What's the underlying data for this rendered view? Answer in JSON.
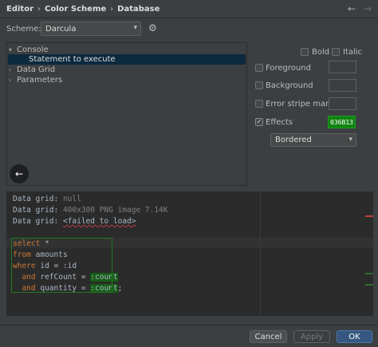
{
  "breadcrumb": {
    "items": [
      "Editor",
      "Color Scheme",
      "Database"
    ],
    "separator": "›"
  },
  "nav": {
    "back": "←",
    "forward": "→"
  },
  "scheme": {
    "label": "Scheme:",
    "value": "Darcula",
    "arrow": "▾",
    "gear": "⚙"
  },
  "tree": {
    "items": [
      {
        "label": "Console",
        "toggle": "▾"
      },
      {
        "label": "Statement to execute",
        "toggle": ""
      },
      {
        "label": "Data Grid",
        "toggle": "›"
      },
      {
        "label": "Parameters",
        "toggle": "›"
      }
    ],
    "back_button": "←"
  },
  "attributes": {
    "bold": "Bold",
    "italic": "Italic",
    "foreground": "Foreground",
    "background": "Background",
    "error_stripe": "Error stripe mark",
    "effects": "Effects",
    "effects_color": "036B13",
    "effects_color_hex": "#118411",
    "effects_type": "Bordered",
    "check": "✓",
    "arrow": "▾"
  },
  "preview": {
    "line1": {
      "label": "Data grid:",
      "value": "null"
    },
    "line2": {
      "label": "Data grid:",
      "value": "400x300 PNG image 7.14K"
    },
    "line3": {
      "label": "Data grid:",
      "value": "<failed to load>"
    },
    "sql": {
      "select": "select",
      "star": "*",
      "from": "from",
      "table": "amounts",
      "where": "where",
      "where_rest": "id = :id",
      "and": "and",
      "ref": "refCount =",
      "param1": ":count",
      "qty": "quantity =",
      "param2": ":count",
      "semi": ";"
    }
  },
  "footer": {
    "cancel": "Cancel",
    "apply": "Apply",
    "ok": "OK"
  }
}
